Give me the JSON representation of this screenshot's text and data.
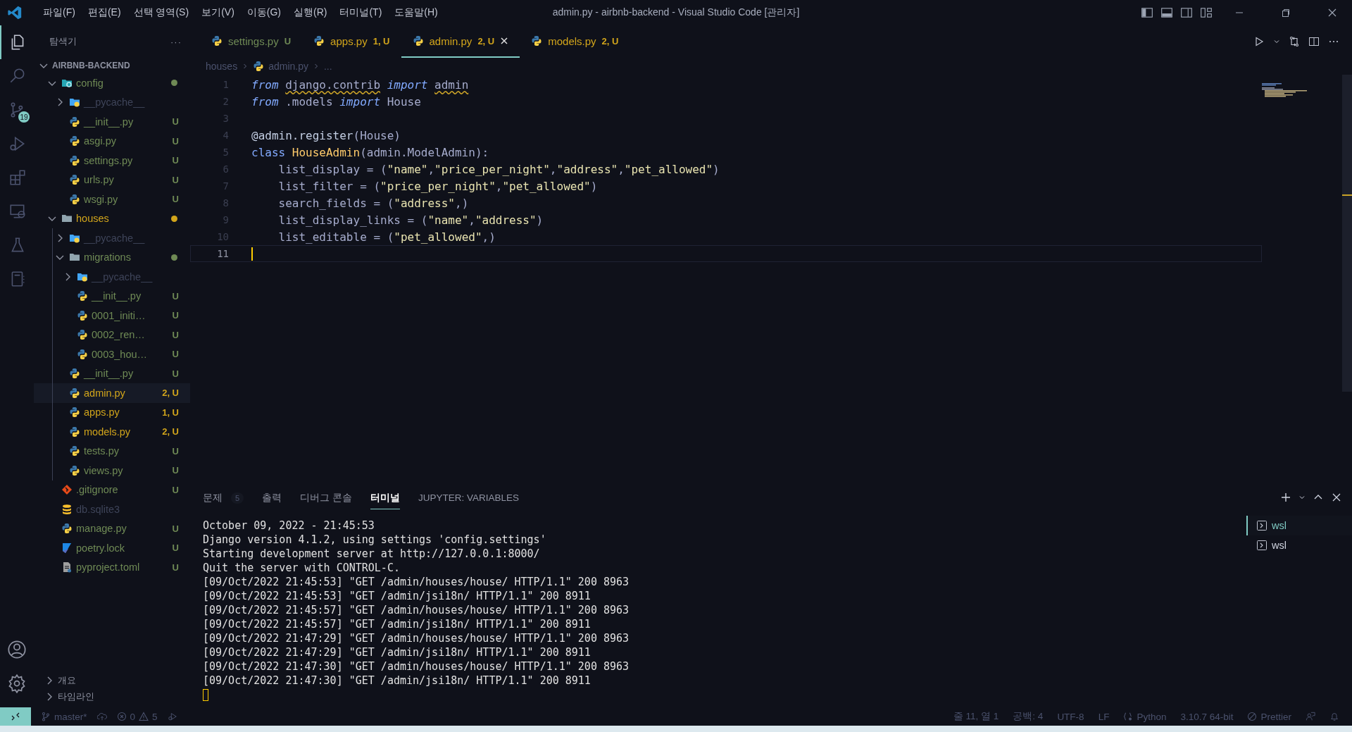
{
  "title_bar": {
    "menus": [
      "파일(F)",
      "편집(E)",
      "선택 영역(S)",
      "보기(V)",
      "이동(G)",
      "실행(R)",
      "터미널(T)",
      "도움말(H)"
    ],
    "title": "admin.py - airbnb-backend - Visual Studio Code [관리자]"
  },
  "activity_bar": {
    "items": [
      {
        "kind": "explorer",
        "selected": true
      },
      {
        "kind": "search",
        "selected": false
      },
      {
        "kind": "git",
        "selected": false,
        "badge": "19"
      },
      {
        "kind": "debug",
        "selected": false
      },
      {
        "kind": "extensions",
        "selected": false
      },
      {
        "kind": "remote",
        "selected": false
      },
      {
        "kind": "testing",
        "selected": false
      },
      {
        "kind": "notebook",
        "selected": false
      }
    ]
  },
  "explorer": {
    "title": "탐색기",
    "more": "···",
    "root": "AIRBNB-BACKEND",
    "items": [
      {
        "name": "config",
        "kind": "folder-config",
        "color": "#6f8a55",
        "dot": true,
        "expanded": true,
        "selected": false,
        "children": [
          {
            "name": "__pycache__",
            "kind": "folder-python",
            "color": "#3e4459",
            "expanded": false,
            "selected": false
          },
          {
            "name": "__init__.py",
            "kind": "python",
            "color": "#6f8a55",
            "badge": "U",
            "selected": false
          },
          {
            "name": "asgi.py",
            "kind": "python",
            "color": "#6f8a55",
            "badge": "U",
            "selected": false
          },
          {
            "name": "settings.py",
            "kind": "python",
            "color": "#6f8a55",
            "badge": "U",
            "selected": false
          },
          {
            "name": "urls.py",
            "kind": "python",
            "color": "#6f8a55",
            "badge": "U",
            "selected": false
          },
          {
            "name": "wsgi.py",
            "kind": "python",
            "color": "#6f8a55",
            "badge": "U",
            "selected": false
          }
        ]
      },
      {
        "name": "houses",
        "kind": "folder",
        "color": "#d2a51b",
        "dot": true,
        "expanded": true,
        "selected": false,
        "children": [
          {
            "name": "__pycache__",
            "kind": "folder-python",
            "color": "#3e4459",
            "expanded": false,
            "selected": false
          },
          {
            "name": "migrations",
            "kind": "folder",
            "color": "#6f8a55",
            "dot": true,
            "expanded": true,
            "selected": false,
            "children": [
              {
                "name": "__pycache__",
                "kind": "folder-python",
                "color": "#3e4459",
                "expanded": false,
                "selected": false
              },
              {
                "name": "__init__.py",
                "kind": "python",
                "color": "#6f8a55",
                "badge": "U",
                "selected": false
              },
              {
                "name": "0001_initi…",
                "kind": "python",
                "color": "#6f8a55",
                "badge": "U",
                "selected": false
              },
              {
                "name": "0002_ren…",
                "kind": "python",
                "color": "#6f8a55",
                "badge": "U",
                "selected": false
              },
              {
                "name": "0003_hou…",
                "kind": "python",
                "color": "#6f8a55",
                "badge": "U",
                "selected": false
              }
            ]
          },
          {
            "name": "__init__.py",
            "kind": "python",
            "color": "#6f8a55",
            "badge": "U",
            "selected": false
          },
          {
            "name": "admin.py",
            "kind": "python",
            "color": "#d2a51b",
            "badge": "2, U",
            "selected": true
          },
          {
            "name": "apps.py",
            "kind": "python",
            "color": "#d2a51b",
            "badge": "1, U",
            "selected": false
          },
          {
            "name": "models.py",
            "kind": "python",
            "color": "#d2a51b",
            "badge": "2, U",
            "selected": false
          },
          {
            "name": "tests.py",
            "kind": "python",
            "color": "#6f8a55",
            "badge": "U",
            "selected": false
          },
          {
            "name": "views.py",
            "kind": "python",
            "color": "#6f8a55",
            "badge": "U",
            "selected": false
          }
        ]
      },
      {
        "name": ".gitignore",
        "kind": "git",
        "color": "#6f8a55",
        "badge": "U",
        "selected": false
      },
      {
        "name": "db.sqlite3",
        "kind": "db",
        "color": "#3e4459",
        "selected": false
      },
      {
        "name": "manage.py",
        "kind": "python",
        "color": "#6f8a55",
        "badge": "U",
        "selected": false
      },
      {
        "name": "poetry.lock",
        "kind": "poetry",
        "color": "#6f8a55",
        "badge": "U",
        "selected": false
      },
      {
        "name": "pyproject.toml",
        "kind": "toml",
        "color": "#6f8a55",
        "badge": "U",
        "selected": false
      }
    ],
    "sections": [
      {
        "label": "개요",
        "expanded": false
      },
      {
        "label": "타임라인",
        "expanded": false
      }
    ]
  },
  "tabs": [
    {
      "label": "settings.py",
      "badge": "U",
      "color": "#6f8a55",
      "selected": false
    },
    {
      "label": "apps.py",
      "badge": "1, U",
      "color": "#d2a51b",
      "selected": false
    },
    {
      "label": "admin.py",
      "badge": "2, U",
      "color": "#d2a51b",
      "selected": true
    },
    {
      "label": "models.py",
      "badge": "2, U",
      "color": "#d2a51b",
      "selected": false
    }
  ],
  "breadcrumb": [
    {
      "text": "houses",
      "kind": "folder"
    },
    {
      "text": "admin.py",
      "kind": "python"
    },
    {
      "text": "...",
      "kind": "symbol"
    }
  ],
  "editor": {
    "lines": [
      {
        "number": "1",
        "tokens": [
          {
            "t": "from ",
            "kind": "kw"
          },
          {
            "t": "django.contrib",
            "kind": "warn"
          },
          {
            "t": " import ",
            "kind": "kw"
          },
          {
            "t": "admin",
            "kind": "warn"
          }
        ]
      },
      {
        "number": "2",
        "tokens": [
          {
            "t": "from",
            "kind": "kw"
          },
          {
            "t": " .models ",
            "kind": "text"
          },
          {
            "t": "import",
            "kind": "kw"
          },
          {
            "t": " House",
            "kind": "text"
          }
        ]
      },
      {
        "number": "3"
      },
      {
        "number": "4",
        "tokens": [
          {
            "t": "@admin.register",
            "kind": "decorator"
          },
          {
            "t": "(House)",
            "kind": "text"
          }
        ]
      },
      {
        "number": "5",
        "tokens": [
          {
            "t": "class ",
            "kind": "storage"
          },
          {
            "t": "HouseAdmin",
            "kind": "class"
          },
          {
            "t": "(admin.ModelAdmin):",
            "kind": "text"
          }
        ]
      },
      {
        "number": "6",
        "tokens": [
          {
            "t": "    list_display = (",
            "kind": "text"
          },
          {
            "t": "\"name\"",
            "kind": "str"
          },
          {
            "t": ",",
            "kind": "text"
          },
          {
            "t": "\"price_per_night\"",
            "kind": "str"
          },
          {
            "t": ",",
            "kind": "text"
          },
          {
            "t": "\"address\"",
            "kind": "str"
          },
          {
            "t": ",",
            "kind": "text"
          },
          {
            "t": "\"pet_allowed\"",
            "kind": "str"
          },
          {
            "t": ")",
            "kind": "text"
          }
        ]
      },
      {
        "number": "7",
        "tokens": [
          {
            "t": "    list_filter = (",
            "kind": "text"
          },
          {
            "t": "\"price_per_night\"",
            "kind": "str"
          },
          {
            "t": ",",
            "kind": "text"
          },
          {
            "t": "\"pet_allowed\"",
            "kind": "str"
          },
          {
            "t": ")",
            "kind": "text"
          }
        ]
      },
      {
        "number": "8",
        "tokens": [
          {
            "t": "    search_fields = (",
            "kind": "text"
          },
          {
            "t": "\"address\"",
            "kind": "str"
          },
          {
            "t": ",)",
            "kind": "text"
          }
        ]
      },
      {
        "number": "9",
        "tokens": [
          {
            "t": "    list_display_links = (",
            "kind": "text"
          },
          {
            "t": "\"name\"",
            "kind": "str"
          },
          {
            "t": ",",
            "kind": "text"
          },
          {
            "t": "\"address\"",
            "kind": "str"
          },
          {
            "t": ")",
            "kind": "text"
          }
        ]
      },
      {
        "number": "10",
        "tokens": [
          {
            "t": "    list_editable = (",
            "kind": "text"
          },
          {
            "t": "\"pet_allowed\"",
            "kind": "str"
          },
          {
            "t": ",)",
            "kind": "text"
          }
        ]
      },
      {
        "number": "11",
        "current": true
      }
    ]
  },
  "panel": {
    "tabs": [
      {
        "label": "문제",
        "count": "5",
        "selected": false
      },
      {
        "label": "출력",
        "selected": false
      },
      {
        "label": "디버그 콘솔",
        "selected": false
      },
      {
        "label": "터미널",
        "selected": true
      },
      {
        "label": "JUPYTER: VARIABLES",
        "selected": false
      }
    ],
    "terminal_lines": [
      "October 09, 2022 - 21:45:53",
      "Django version 4.1.2, using settings 'config.settings'",
      "Starting development server at http://127.0.0.1:8000/",
      "Quit the server with CONTROL-C.",
      "[09/Oct/2022 21:45:53] \"GET /admin/houses/house/ HTTP/1.1\" 200 8963",
      "[09/Oct/2022 21:45:53] \"GET /admin/jsi18n/ HTTP/1.1\" 200 8911",
      "[09/Oct/2022 21:45:57] \"GET /admin/houses/house/ HTTP/1.1\" 200 8963",
      "[09/Oct/2022 21:45:57] \"GET /admin/jsi18n/ HTTP/1.1\" 200 8911",
      "[09/Oct/2022 21:47:29] \"GET /admin/houses/house/ HTTP/1.1\" 200 8963",
      "[09/Oct/2022 21:47:29] \"GET /admin/jsi18n/ HTTP/1.1\" 200 8911",
      "[09/Oct/2022 21:47:30] \"GET /admin/houses/house/ HTTP/1.1\" 200 8963",
      "[09/Oct/2022 21:47:30] \"GET /admin/jsi18n/ HTTP/1.1\" 200 8911"
    ],
    "terminals": [
      {
        "label": "wsl",
        "selected": true
      },
      {
        "label": "wsl",
        "selected": false
      }
    ]
  },
  "status_bar": {
    "branch": "master*",
    "errors": "0",
    "warnings": "5",
    "right": [
      {
        "text": "줄 11, 열 1",
        "kind": "plain"
      },
      {
        "text": "공백: 4",
        "kind": "plain"
      },
      {
        "text": "UTF-8",
        "kind": "plain"
      },
      {
        "text": "LF",
        "kind": "plain"
      },
      {
        "text": "Python",
        "kind": "language"
      },
      {
        "text": "3.10.7 64-bit",
        "kind": "plain"
      },
      {
        "text": "Prettier",
        "kind": "formatter"
      }
    ]
  }
}
